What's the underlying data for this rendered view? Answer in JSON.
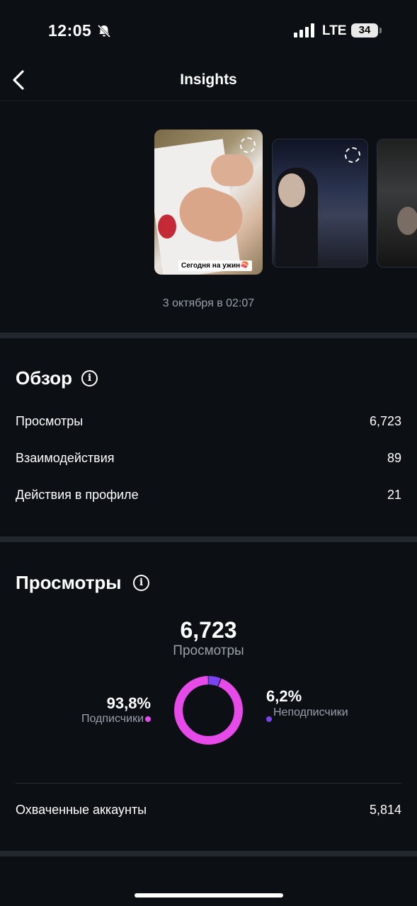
{
  "status_bar": {
    "time": "12:05",
    "network": "LTE",
    "battery": "34",
    "icons": [
      "bell-off-icon",
      "signal-icon",
      "battery-icon"
    ]
  },
  "header": {
    "title": "Insights",
    "back_icon": "chevron-left-icon"
  },
  "stories": {
    "caption": "Сегодня на ужин🍣",
    "date": "3 октября в 02:07"
  },
  "overview": {
    "title": "Обзор",
    "info_icon": "info-icon",
    "rows": [
      {
        "label": "Просмотры",
        "value": "6,723"
      },
      {
        "label": "Взаимодействия",
        "value": "89"
      },
      {
        "label": "Действия в профиле",
        "value": "21"
      }
    ]
  },
  "views": {
    "title": "Просмотры",
    "info_icon": "info-icon",
    "total": "6,723",
    "total_label": "Просмотры",
    "followers_pct": "93,8%",
    "followers_label": "Подписчики",
    "non_followers_pct": "6,2%",
    "non_followers_label": "Неподписчики",
    "accounts_label": "Охваченные аккаунты",
    "accounts_value": "5,814"
  },
  "chart_data": {
    "type": "pie",
    "categories": [
      "Подписчики",
      "Неподписчики"
    ],
    "values": [
      93.8,
      6.2
    ],
    "colors": [
      "#e64ae8",
      "#7b43f0"
    ],
    "title": "",
    "style": "donut"
  }
}
